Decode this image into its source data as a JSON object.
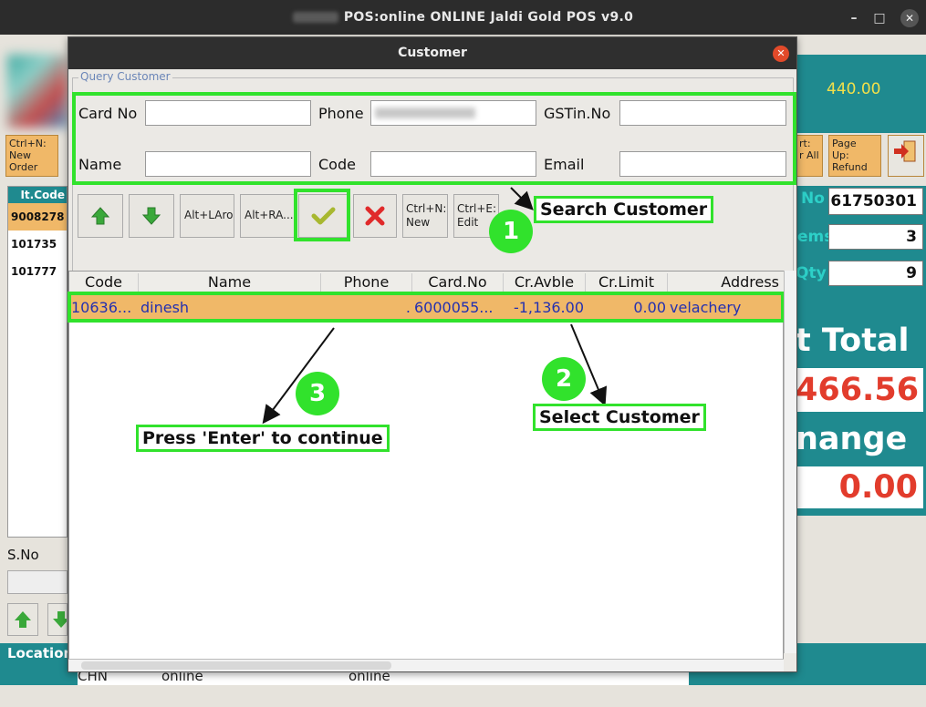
{
  "window": {
    "title": "POS:online    ONLINE Jaldi Gold POS v9.0",
    "minimize": "–",
    "maximize": "□",
    "close": "✕"
  },
  "background": {
    "amount_top": "440.00",
    "buttons": {
      "new_order": "Ctrl+N:\nNew\nOrder",
      "clear_all": "rt:\nr All",
      "refund": "Page\nUp:\nRefund"
    },
    "items_list": {
      "header": "It.Code",
      "rows": [
        "9008278",
        "101735",
        "101777"
      ]
    },
    "right_panel": {
      "no_label": "No",
      "no_value": "61750301",
      "items_label": "ems",
      "items_value": "3",
      "qty_label": "Qty",
      "qty_value": "9",
      "total_label": "t Total",
      "total_value": "466.56",
      "change_label": "nange",
      "change_value": "0.00"
    },
    "sno_label": "S.No",
    "location_label": "Location",
    "bottom_row": {
      "c1": "CHN",
      "c2": "online",
      "c3": "online"
    }
  },
  "dialog": {
    "title": "Customer",
    "close": "✕",
    "query_legend": "Query Customer",
    "fields": {
      "card_no_label": "Card No",
      "phone_label": "Phone",
      "gstin_label": "GSTin.No",
      "name_label": "Name",
      "code_label": "Code",
      "email_label": "Email"
    },
    "toolbar": {
      "up": "▲",
      "down": "▼",
      "alt_left": "Alt+LAro",
      "alt_right": "Alt+RA...",
      "ok": "✔",
      "cancel": "✖",
      "new": "Ctrl+N:\nNew",
      "edit": "Ctrl+E:\nEdit"
    },
    "table": {
      "columns": [
        "Code",
        "Name",
        "Phone",
        "Card.No",
        "Cr.Avble",
        "Cr.Limit",
        "Address"
      ],
      "rows": [
        {
          "code": "10636...",
          "name": "dinesh",
          "phone": ".",
          "card_no": "6000055...",
          "cr_avble": "-1,136.00",
          "cr_limit": "0.00",
          "address": "velachery"
        }
      ]
    }
  },
  "annotations": {
    "search_customer": "Search Customer",
    "select_customer": "Select Customer",
    "press_enter": "Press 'Enter' to continue",
    "step1": "1",
    "step2": "2",
    "step3": "3"
  }
}
